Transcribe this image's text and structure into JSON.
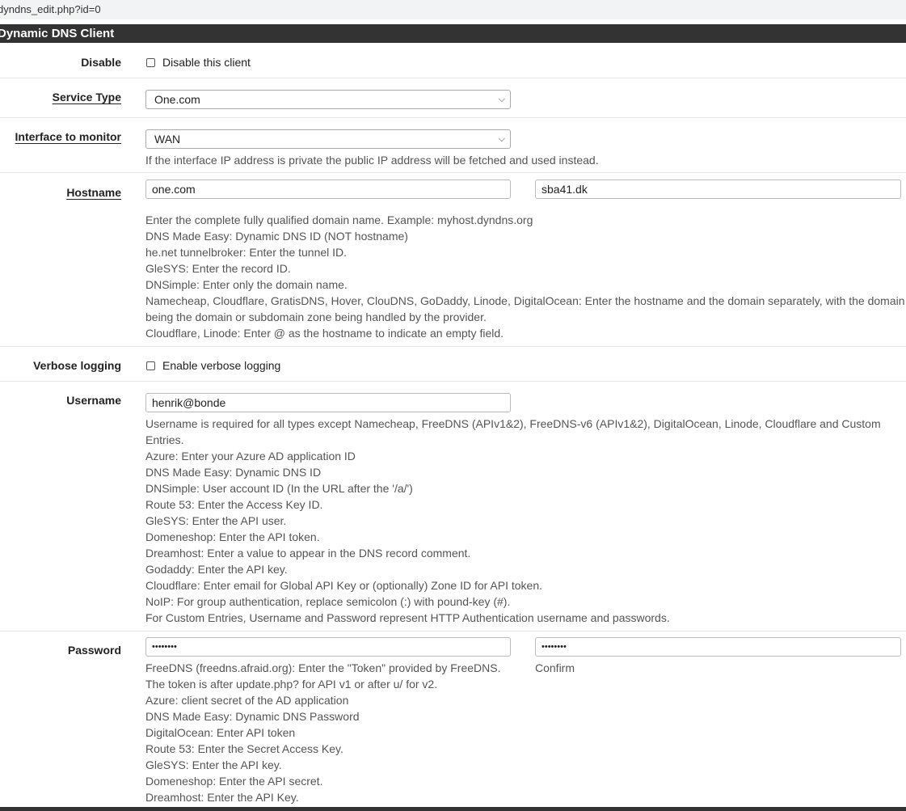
{
  "url": "dyndns_edit.php?id=0",
  "panel": {
    "title": "Dynamic DNS Client"
  },
  "disable": {
    "label": "Disable",
    "checkbox_label": "Disable this client",
    "checked": false
  },
  "service_type": {
    "label": "Service Type",
    "value": "One.com"
  },
  "interface": {
    "label": "Interface to monitor",
    "value": "WAN",
    "help": "If the interface IP address is private the public IP address will be fetched and used instead."
  },
  "hostname": {
    "label": "Hostname",
    "host_value": "one.com",
    "domain_value": "sba41.dk",
    "help": [
      "Enter the complete fully qualified domain name. Example: myhost.dyndns.org",
      "DNS Made Easy: Dynamic DNS ID (NOT hostname)",
      "he.net tunnelbroker: Enter the tunnel ID.",
      "GleSYS: Enter the record ID.",
      "DNSimple: Enter only the domain name.",
      "Namecheap, Cloudflare, GratisDNS, Hover, ClouDNS, GoDaddy, Linode, DigitalOcean: Enter the hostname and the domain separately, with the domain",
      "being the domain or subdomain zone being handled by the provider.",
      "Cloudflare, Linode: Enter @ as the hostname to indicate an empty field."
    ]
  },
  "verbose": {
    "label": "Verbose logging",
    "checkbox_label": "Enable verbose logging",
    "checked": false
  },
  "username": {
    "label": "Username",
    "value": "henrik@bonde",
    "help": [
      "Username is required for all types except Namecheap, FreeDNS (APIv1&2), FreeDNS-v6 (APIv1&2), DigitalOcean, Linode, Cloudflare and Custom",
      "Entries.",
      "Azure: Enter your Azure AD application ID",
      "DNS Made Easy: Dynamic DNS ID",
      "DNSimple: User account ID (In the URL after the '/a/')",
      "Route 53: Enter the Access Key ID.",
      "GleSYS: Enter the API user.",
      "Domeneshop: Enter the API token.",
      "Dreamhost: Enter a value to appear in the DNS record comment.",
      "Godaddy: Enter the API key.",
      "Cloudflare: Enter email for Global API Key or (optionally) Zone ID for API token.",
      "NoIP: For group authentication, replace semicolon (:) with pound-key (#).",
      "For Custom Entries, Username and Password represent HTTP Authentication username and passwords."
    ]
  },
  "password": {
    "label": "Password",
    "value_masked": "••••••••",
    "confirm_masked": "••••••••",
    "confirm_label": "Confirm",
    "help": [
      "FreeDNS (freedns.afraid.org): Enter the \"Token\" provided by FreeDNS.",
      "The token is after update.php? for API v1 or after u/ for v2.",
      "Azure: client secret of the AD application",
      "DNS Made Easy: Dynamic DNS Password",
      "DigitalOcean: Enter API token",
      "Route 53: Enter the Secret Access Key.",
      "GleSYS: Enter the API key.",
      "Domeneshop: Enter the API secret.",
      "Dreamhost: Enter the API Key."
    ]
  }
}
